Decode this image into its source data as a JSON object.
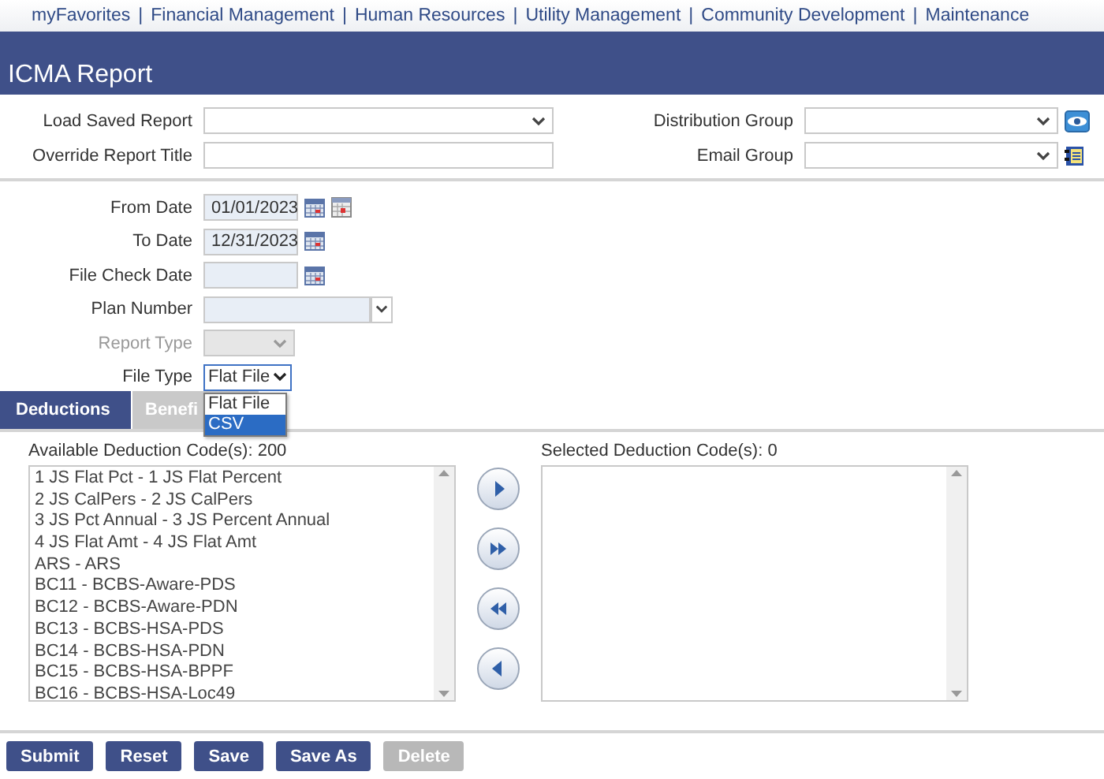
{
  "nav_separator": "|",
  "nav": [
    "myFavorites",
    "Financial Management",
    "Human Resources",
    "Utility Management",
    "Community Development",
    "Maintenance"
  ],
  "title": "ICMA Report",
  "report_left": [
    {
      "label": "Load Saved Report",
      "kind": "select"
    },
    {
      "label": "Override Report Title",
      "kind": "text"
    }
  ],
  "report_right": [
    {
      "label": "Distribution Group",
      "kind": "select"
    },
    {
      "label": "Email Group",
      "kind": "select"
    }
  ],
  "criteria": [
    {
      "label": "From Date",
      "kind": "date",
      "value": "01/01/2023"
    },
    {
      "label": "To Date",
      "kind": "date",
      "value": "12/31/2023"
    },
    {
      "label": "File Check Date",
      "kind": "date"
    },
    {
      "label": "Plan Number",
      "kind": "combo"
    },
    {
      "label": "Report Type",
      "kind": "select",
      "disabled": true
    },
    {
      "label": "File Type",
      "kind": "filetype",
      "value": "Flat File"
    }
  ],
  "file_type_options": [
    {
      "label": "Flat File",
      "selected": false
    },
    {
      "label": "CSV",
      "selected": true
    }
  ],
  "tabs": [
    {
      "label": "Deductions",
      "selected": true
    },
    {
      "label": "Benefi",
      "selected": false
    }
  ],
  "available": {
    "label": "Available Deduction Code(s): 200",
    "items": [
      "1 JS Flat Pct - 1 JS Flat Percent",
      "2 JS CalPers - 2 JS CalPers",
      "3 JS Pct Annual - 3 JS Percent Annual",
      "4 JS Flat Amt - 4 JS Flat Amt",
      "ARS - ARS",
      "BC11 - BCBS-Aware-PDS",
      "BC12 - BCBS-Aware-PDN",
      "BC13 - BCBS-HSA-PDS",
      "BC14 - BCBS-HSA-PDN",
      "BC15 - BCBS-HSA-BPPF",
      "BC16 - BCBS-HSA-Loc49"
    ]
  },
  "selected": {
    "label": "Selected Deduction Code(s): 0"
  },
  "buttons": [
    {
      "label": "Submit",
      "disabled": false
    },
    {
      "label": "Reset",
      "disabled": false
    },
    {
      "label": "Save",
      "disabled": false
    },
    {
      "label": "Save As",
      "disabled": false
    },
    {
      "label": "Delete",
      "disabled": true
    }
  ]
}
